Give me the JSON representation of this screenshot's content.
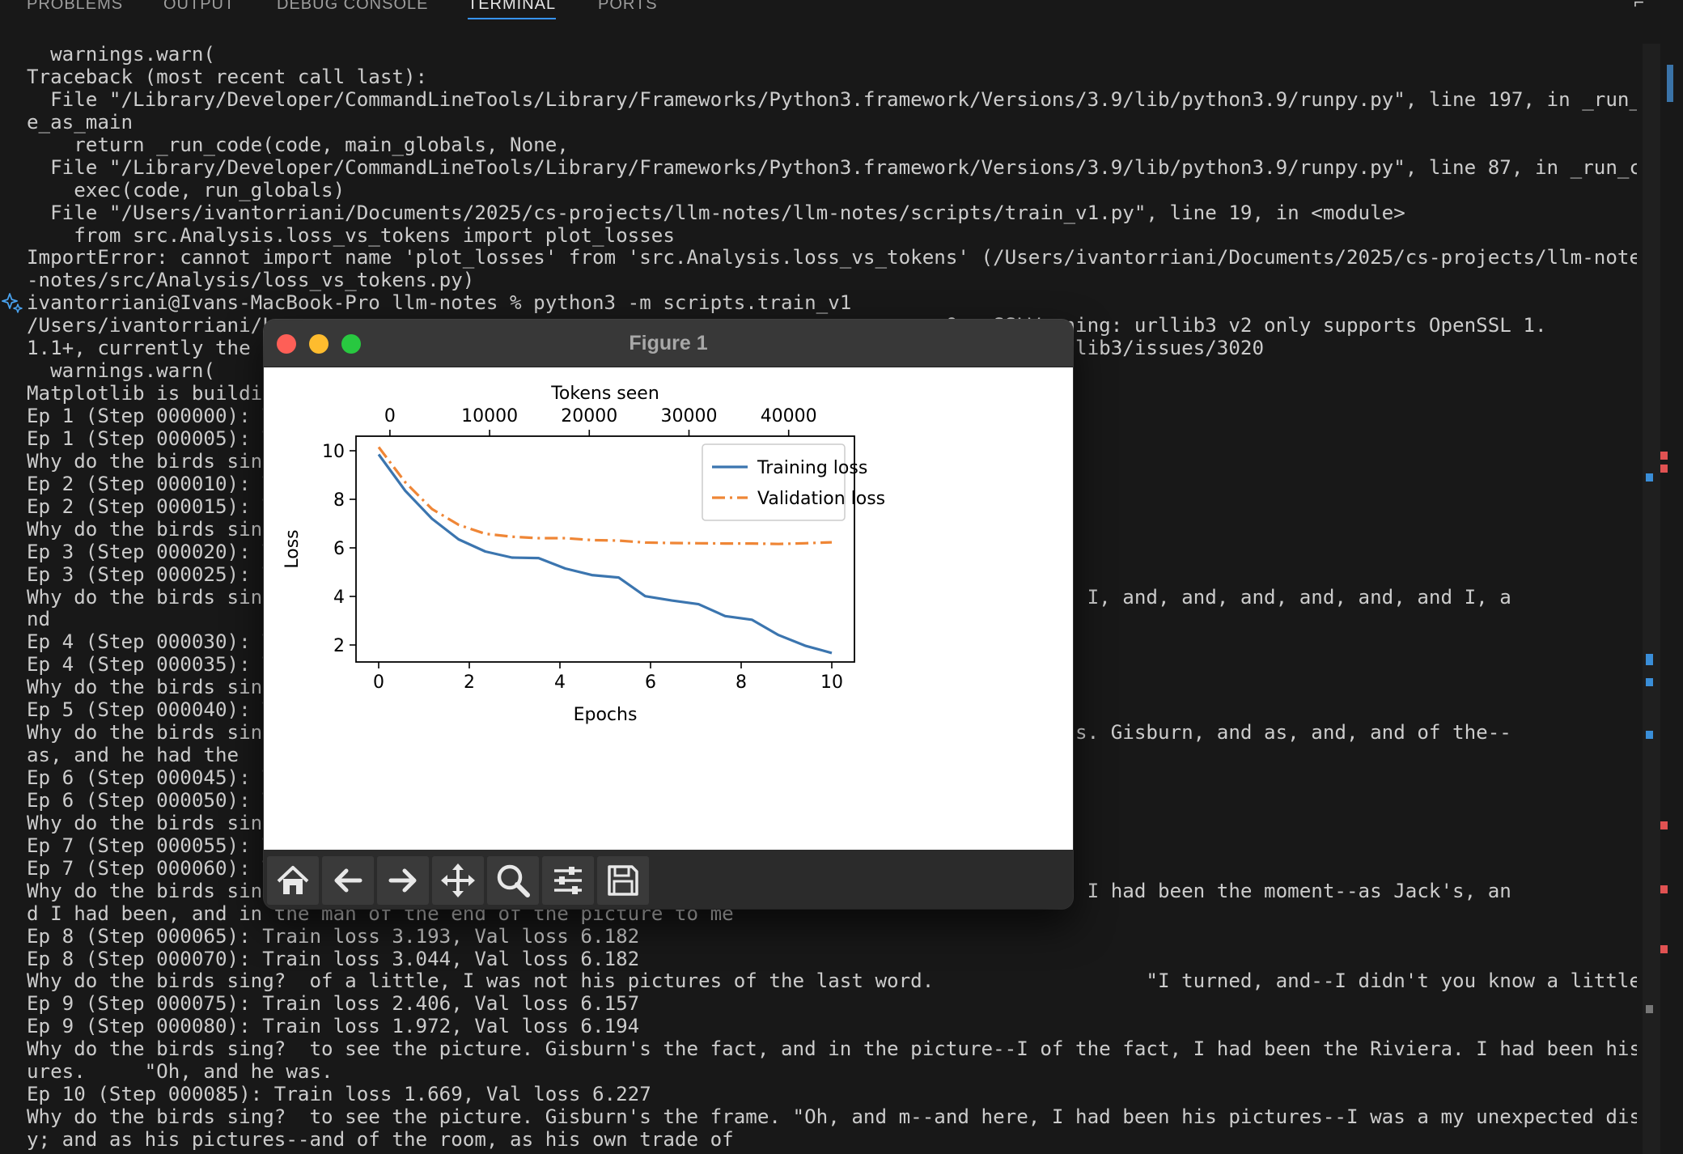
{
  "panel": {
    "tabs": [
      {
        "label": "PROBLEMS",
        "active": false
      },
      {
        "label": "OUTPUT",
        "active": false
      },
      {
        "label": "DEBUG CONSOLE",
        "active": false
      },
      {
        "label": "TERMINAL",
        "active": true
      },
      {
        "label": "PORTS",
        "active": false
      }
    ],
    "accent_color": "#3794ff"
  },
  "terminal": {
    "lines": [
      "  warnings.warn(",
      "Traceback (most recent call last):",
      "  File \"/Library/Developer/CommandLineTools/Library/Frameworks/Python3.framework/Versions/3.9/lib/python3.9/runpy.py\", line 197, in _run_modul",
      "e_as_main",
      "    return _run_code(code, main_globals, None,",
      "  File \"/Library/Developer/CommandLineTools/Library/Frameworks/Python3.framework/Versions/3.9/lib/python3.9/runpy.py\", line 87, in _run_code",
      "    exec(code, run_globals)",
      "  File \"/Users/ivantorriani/Documents/2025/cs-projects/llm-notes/llm-notes/scripts/train_v1.py\", line 19, in <module>",
      "    from src.Analysis.loss_vs_tokens import plot_losses",
      "ImportError: cannot import name 'plot_losses' from 'src.Analysis.loss_vs_tokens' (/Users/ivantorriani/Documents/2025/cs-projects/llm-notes/llm",
      "-notes/src/Analysis/loss_vs_tokens.py)",
      "ivantorriani@Ivans-MacBook-Pro llm-notes % python3 -m scripts.train_v1",
      "/Users/ivantorriani/L                                                         OpenSSLWarning: urllib3 v2 only supports OpenSSL 1.",
      "1.1+, currently the '                                                         urllib3/urllib3/issues/3020",
      "  warnings.warn(",
      "Matplotlib is buildin",
      "Ep 1 (Step 000000): T",
      "Ep 1 (Step 000005): T",
      "Why do the birds sing",
      "Ep 2 (Step 000010): T",
      "Ep 2 (Step 000015): T",
      "Why do the birds sing",
      "Ep 3 (Step 000020): T",
      "Ep 3 (Step 000025): T",
      "Why do the birds sing                                                       d I, and, and I, and, and, and, and, and, and I, a",
      "nd",
      "Ep 4 (Step 000030): T",
      "Ep 4 (Step 000035): T",
      "Why do the birds sing",
      "Ep 5 (Step 000040): T",
      "Why do the birds sing                                                       and of the--as. Gisburn, and as, and, and of the--",
      "as, and he had the",
      "Ep 6 (Step 000045): T",
      "Ep 6 (Step 000050): T",
      "Why do the birds sing                                                       tle.",
      "Ep 7 (Step 000055): T",
      "Ep 7 (Step 000060): T",
      "Why do the birds sing                                                       the fact, and I had been the moment--as Jack's, an",
      "d I had been, and in the man of the end of the picture to me",
      "Ep 8 (Step 000065): Train loss 3.193, Val loss 6.182",
      "Ep 8 (Step 000070): Train loss 3.044, Val loss 6.182",
      "Why do the birds sing?  of a little, I was not his pictures of the last word.                  \"I turned, and--I didn't you know a little.",
      "Ep 9 (Step 000075): Train loss 2.406, Val loss 6.157",
      "Ep 9 (Step 000080): Train loss 1.972, Val loss 6.194",
      "Why do the birds sing?  to see the picture. Gisburn's the fact, and in the picture--I of the fact, I had been the Riviera. I had been his pict",
      "ures.     \"Oh, and he was.",
      "Ep 10 (Step 000085): Train loss 1.669, Val loss 6.227",
      "Why do the birds sing?  to see the picture. Gisburn's the frame. \"Oh, and m--and here, I had been his pictures--I was a my unexpected discover",
      "y; and as his pictures--and of the room, as his own trade of"
    ],
    "prompt_icon": "sparkle-icon"
  },
  "figure_window": {
    "title": "Figure 1",
    "traffic_lights": {
      "close": "#fe5f57",
      "minimize": "#febc2e",
      "maximize": "#28c840"
    },
    "toolbar": [
      {
        "name": "home-icon"
      },
      {
        "name": "back-arrow-icon"
      },
      {
        "name": "forward-arrow-icon"
      },
      {
        "name": "pan-icon"
      },
      {
        "name": "zoom-icon"
      },
      {
        "name": "configure-subplots-icon"
      },
      {
        "name": "save-icon"
      }
    ]
  },
  "chart_data": {
    "type": "line",
    "xlabel": "Epochs",
    "ylabel": "Loss",
    "top_xlabel": "Tokens seen",
    "xlim": [
      -0.5,
      10.5
    ],
    "ylim": [
      1.3,
      10.6
    ],
    "xticks": [
      0,
      2,
      4,
      6,
      8,
      10
    ],
    "yticks": [
      2,
      4,
      6,
      8,
      10
    ],
    "top_xlim": [
      -3400,
      46600
    ],
    "top_xticks": [
      0,
      10000,
      20000,
      30000,
      40000
    ],
    "legend_position": "top-right",
    "grid": false,
    "x": [
      0,
      0.588,
      1.176,
      1.765,
      2.353,
      2.941,
      3.529,
      4.118,
      4.706,
      5.294,
      5.882,
      6.471,
      7.059,
      7.647,
      8.235,
      8.824,
      9.412,
      10.0
    ],
    "series": [
      {
        "name": "Training loss",
        "color": "#3b75af",
        "style": "solid",
        "values": [
          9.85,
          8.35,
          7.2,
          6.35,
          5.85,
          5.6,
          5.58,
          5.15,
          4.88,
          4.78,
          4.01,
          3.83,
          3.68,
          3.19,
          3.04,
          2.41,
          1.97,
          1.67
        ]
      },
      {
        "name": "Validation loss",
        "color": "#ef8636",
        "style": "dashdot",
        "values": [
          10.15,
          8.7,
          7.6,
          6.95,
          6.58,
          6.46,
          6.4,
          6.4,
          6.32,
          6.3,
          6.22,
          6.2,
          6.19,
          6.18,
          6.18,
          6.16,
          6.19,
          6.23
        ]
      }
    ]
  }
}
